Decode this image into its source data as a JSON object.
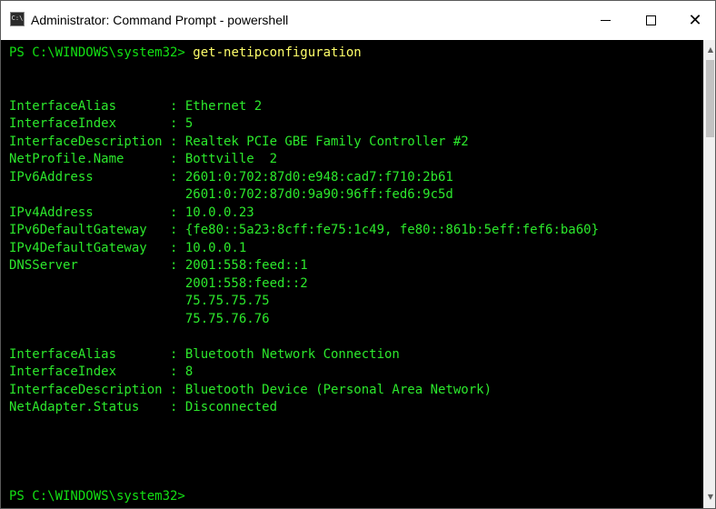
{
  "window": {
    "title": "Administrator: Command Prompt - powershell",
    "icon": "cmd-icon",
    "icon_label": "C:\\",
    "minimize_glyph": "minimize-icon",
    "maximize_glyph": "maximize-icon",
    "close_glyph": "✕"
  },
  "colors": {
    "console_bg": "#000000",
    "prompt": "#13e013",
    "command": "#ffff6a",
    "output": "#2ce82c"
  },
  "console": {
    "prompt": "PS C:\\WINDOWS\\system32> ",
    "command": "get-netipconfiguration",
    "output_lines": [
      "",
      "",
      "InterfaceAlias       : Ethernet 2",
      "InterfaceIndex       : 5",
      "InterfaceDescription : Realtek PCIe GBE Family Controller #2",
      "NetProfile.Name      : Bottville  2",
      "IPv6Address          : 2601:0:702:87d0:e948:cad7:f710:2b61",
      "                       2601:0:702:87d0:9a90:96ff:fed6:9c5d",
      "IPv4Address          : 10.0.0.23",
      "IPv6DefaultGateway   : {fe80::5a23:8cff:fe75:1c49, fe80::861b:5eff:fef6:ba60}",
      "IPv4DefaultGateway   : 10.0.0.1",
      "DNSServer            : 2001:558:feed::1",
      "                       2001:558:feed::2",
      "                       75.75.75.75",
      "                       75.75.76.76",
      "",
      "InterfaceAlias       : Bluetooth Network Connection",
      "InterfaceIndex       : 8",
      "InterfaceDescription : Bluetooth Device (Personal Area Network)",
      "NetAdapter.Status    : Disconnected",
      "",
      "",
      "",
      ""
    ],
    "final_prompt": "PS C:\\WINDOWS\\system32>"
  },
  "scrollbar": {
    "up_arrow": "▲",
    "down_arrow": "▼"
  }
}
